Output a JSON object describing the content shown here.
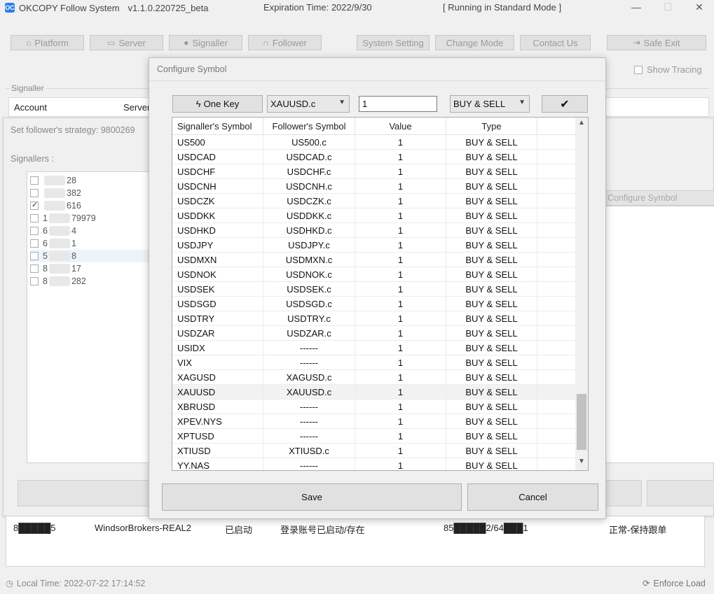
{
  "app": {
    "icon_text": "OC",
    "title": "OKCOPY Follow System",
    "version": "v1.1.0.220725_beta",
    "expiration": "Expiration Time: 2022/9/30",
    "mode": "[ Running in Standard Mode ]"
  },
  "nav": {
    "platform": "Platform",
    "server": "Server",
    "signaller": "Signaller",
    "follower": "Follower",
    "system_setting": "System Setting",
    "change_mode": "Change Mode",
    "contact_us": "Contact Us",
    "safe_exit": "Safe Exit"
  },
  "show_tracing": "Show Tracing",
  "signaller_group": {
    "title": "Signaller",
    "col_account": "Account",
    "col_server": "Server"
  },
  "strategy": {
    "title": "Set follower's strategy: 9800269",
    "signallers_label": "Signallers :",
    "configure_tab": "Configure Symbol",
    "items": [
      {
        "pre": "",
        "post": "28",
        "checked": false
      },
      {
        "pre": "",
        "post": "382",
        "checked": false
      },
      {
        "pre": "",
        "post": "616",
        "checked": true
      },
      {
        "pre": "1",
        "post": "79979",
        "checked": false
      },
      {
        "pre": "6",
        "post": "4",
        "checked": false
      },
      {
        "pre": "6",
        "post": "1",
        "checked": false
      },
      {
        "pre": "5",
        "post": "8",
        "checked": false
      },
      {
        "pre": "8",
        "post": "17",
        "checked": false
      },
      {
        "pre": "8",
        "post": "282",
        "checked": false
      }
    ]
  },
  "bottom": {
    "account": "8█████5",
    "server": "WindsorBrokers-REAL2",
    "status": "已启动",
    "message": "登录账号已启动/存在",
    "accounts": "85█████2/64███1",
    "state": "正常-保持跟单",
    "local_time": "Local Time:  2022-07-22 17:14:52",
    "enforce": "Enforce Load"
  },
  "dialog": {
    "title": "Configure Symbol",
    "one_key": "One Key",
    "symbol_select": "XAUUSD.c",
    "value_input": "1",
    "type_select": "BUY & SELL",
    "save": "Save",
    "cancel": "Cancel",
    "columns": [
      "Signaller's Symbol",
      "Follower's Symbol",
      "Value",
      "Type"
    ],
    "rows": [
      {
        "sig": "US500",
        "fol": "US500.c",
        "val": "1",
        "type": "BUY & SELL"
      },
      {
        "sig": "USDCAD",
        "fol": "USDCAD.c",
        "val": "1",
        "type": "BUY & SELL"
      },
      {
        "sig": "USDCHF",
        "fol": "USDCHF.c",
        "val": "1",
        "type": "BUY & SELL"
      },
      {
        "sig": "USDCNH",
        "fol": "USDCNH.c",
        "val": "1",
        "type": "BUY & SELL"
      },
      {
        "sig": "USDCZK",
        "fol": "USDCZK.c",
        "val": "1",
        "type": "BUY & SELL"
      },
      {
        "sig": "USDDKK",
        "fol": "USDDKK.c",
        "val": "1",
        "type": "BUY & SELL"
      },
      {
        "sig": "USDHKD",
        "fol": "USDHKD.c",
        "val": "1",
        "type": "BUY & SELL"
      },
      {
        "sig": "USDJPY",
        "fol": "USDJPY.c",
        "val": "1",
        "type": "BUY & SELL"
      },
      {
        "sig": "USDMXN",
        "fol": "USDMXN.c",
        "val": "1",
        "type": "BUY & SELL"
      },
      {
        "sig": "USDNOK",
        "fol": "USDNOK.c",
        "val": "1",
        "type": "BUY & SELL"
      },
      {
        "sig": "USDSEK",
        "fol": "USDSEK.c",
        "val": "1",
        "type": "BUY & SELL"
      },
      {
        "sig": "USDSGD",
        "fol": "USDSGD.c",
        "val": "1",
        "type": "BUY & SELL"
      },
      {
        "sig": "USDTRY",
        "fol": "USDTRY.c",
        "val": "1",
        "type": "BUY & SELL"
      },
      {
        "sig": "USDZAR",
        "fol": "USDZAR.c",
        "val": "1",
        "type": "BUY & SELL"
      },
      {
        "sig": "USIDX",
        "fol": "------",
        "val": "1",
        "type": "BUY & SELL"
      },
      {
        "sig": "VIX",
        "fol": "------",
        "val": "1",
        "type": "BUY & SELL"
      },
      {
        "sig": "XAGUSD",
        "fol": "XAGUSD.c",
        "val": "1",
        "type": "BUY & SELL"
      },
      {
        "sig": "XAUUSD",
        "fol": "XAUUSD.c",
        "val": "1",
        "type": "BUY & SELL",
        "selected": true
      },
      {
        "sig": "XBRUSD",
        "fol": "------",
        "val": "1",
        "type": "BUY & SELL"
      },
      {
        "sig": "XPEV.NYS",
        "fol": "------",
        "val": "1",
        "type": "BUY & SELL"
      },
      {
        "sig": "XPTUSD",
        "fol": "------",
        "val": "1",
        "type": "BUY & SELL"
      },
      {
        "sig": "XTIUSD",
        "fol": "XTIUSD.c",
        "val": "1",
        "type": "BUY & SELL"
      },
      {
        "sig": "YY.NAS",
        "fol": "------",
        "val": "1",
        "type": "BUY & SELL"
      }
    ]
  }
}
